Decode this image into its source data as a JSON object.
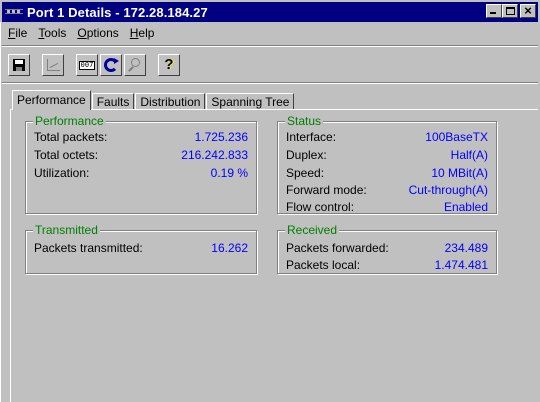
{
  "window": {
    "title": "Port 1 Details - 172.28.184.27",
    "title_bar_color": "#000080"
  },
  "menu": [
    {
      "label_u": "F",
      "label_rest": "ile"
    },
    {
      "label_u": "T",
      "label_rest": "ools"
    },
    {
      "label_u": "O",
      "label_rest": "ptions"
    },
    {
      "label_u": "H",
      "label_rest": "elp"
    }
  ],
  "toolbar": {
    "save_icon": "floppy-disk-icon",
    "chart_icon": "line-chart-icon",
    "counter_text": "007",
    "refresh_icon": "refresh-icon",
    "zoom_icon": "magnifier-icon",
    "help_text": "?"
  },
  "tabs": [
    {
      "label": "Performance",
      "active": true
    },
    {
      "label": "Faults",
      "active": false
    },
    {
      "label": "Distribution",
      "active": false
    },
    {
      "label": "Spanning Tree",
      "active": false
    }
  ],
  "performance": {
    "title": "Performance",
    "rows": [
      {
        "label": "Total packets:",
        "value": "1.725.236"
      },
      {
        "label": "Total octets:",
        "value": "216.242.833"
      },
      {
        "label": "Utilization:",
        "value": "0.19 %"
      }
    ]
  },
  "status": {
    "title": "Status",
    "rows": [
      {
        "label": "Interface:",
        "value": "100BaseTX"
      },
      {
        "label": "Duplex:",
        "value": "Half(A)"
      },
      {
        "label": "Speed:",
        "value": "10 MBit(A)"
      },
      {
        "label": "Forward mode:",
        "value": "Cut-through(A)"
      },
      {
        "label": "Flow control:",
        "value": "Enabled"
      }
    ]
  },
  "transmitted": {
    "title": "Transmitted",
    "rows": [
      {
        "label": "Packets transmitted:",
        "value": "16.262"
      }
    ]
  },
  "received": {
    "title": "Received",
    "rows": [
      {
        "label": "Packets forwarded:",
        "value": "234.489"
      },
      {
        "label": "Packets local:",
        "value": "1.474.481"
      }
    ]
  },
  "colors": {
    "group_title": "#008000",
    "value_text": "#0000ff",
    "background": "#c0c0c0"
  }
}
